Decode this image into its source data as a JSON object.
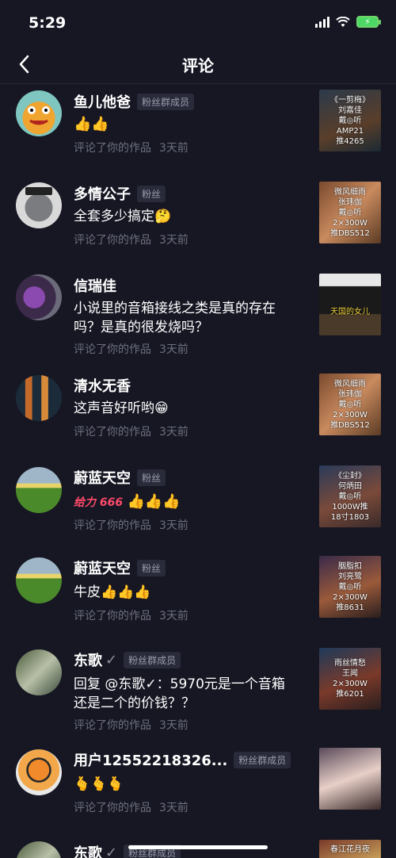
{
  "status": {
    "time": "5:29"
  },
  "nav": {
    "title": "评论"
  },
  "items": [
    {
      "name": "鱼儿他爸",
      "badge": "粉丝群成员",
      "comment": "👍👍",
      "action": "评论了你的作品",
      "time": "3天前",
      "thumb": [
        "《一剪梅》",
        "刘嘉佳",
        "戴◎听",
        "AMP21",
        "推4265"
      ]
    },
    {
      "name": "多情公子",
      "badge": "粉丝",
      "comment": "全套多少搞定🤔",
      "action": "评论了你的作品",
      "time": "3天前",
      "thumb": [
        "微风细雨",
        "张玮伽",
        "戴◎听",
        "2×300W",
        "推DBS512"
      ]
    },
    {
      "name": "信瑞佳",
      "badge": "",
      "comment": "小说里的音箱接线之类是真的存在吗？是真的很发烧吗？",
      "action": "评论了你的作品",
      "time": "3天前",
      "thumb": [
        "天国的女儿"
      ]
    },
    {
      "name": "清水无香",
      "badge": "",
      "comment": "这声音好听哟😁",
      "action": "评论了你的作品",
      "time": "3天前",
      "thumb": [
        "微风细雨",
        "张玮伽",
        "戴◎听",
        "2×300W",
        "推DBS512"
      ]
    },
    {
      "name": "蔚蓝天空",
      "badge": "粉丝",
      "comment_prefix": "给力 666",
      "comment": "👍👍👍",
      "action": "评论了你的作品",
      "time": "3天前",
      "thumb": [
        "《尘封》",
        "何炳田",
        "戴◎听",
        "1000W推",
        "18寸1803"
      ]
    },
    {
      "name": "蔚蓝天空",
      "badge": "粉丝",
      "comment": "牛皮👍👍👍",
      "action": "评论了你的作品",
      "time": "3天前",
      "thumb": [
        "胭脂扣",
        "刘亮鹭",
        "戴◎听",
        "2×300W",
        "推8631"
      ]
    },
    {
      "name": "东歌",
      "badge": "粉丝群成员",
      "verified": "✓",
      "comment": "回复 @东歌✓：5970元是一个音箱还是二个的价钱？？",
      "action": "评论了你的作品",
      "time": "3天前",
      "thumb": [
        "雨丝情愁",
        "王闻",
        "2×300W",
        "推6201"
      ]
    },
    {
      "name": "用户12552218326...",
      "badge": "粉丝群成员",
      "comment": "🫰🫰🫰",
      "action": "评论了你的作品",
      "time": "3天前",
      "thumb": []
    },
    {
      "name": "东歌",
      "badge": "粉丝群成员",
      "verified": "✓",
      "comment": "",
      "action": "",
      "time": "",
      "thumb": [
        "春江花月夜"
      ]
    }
  ]
}
